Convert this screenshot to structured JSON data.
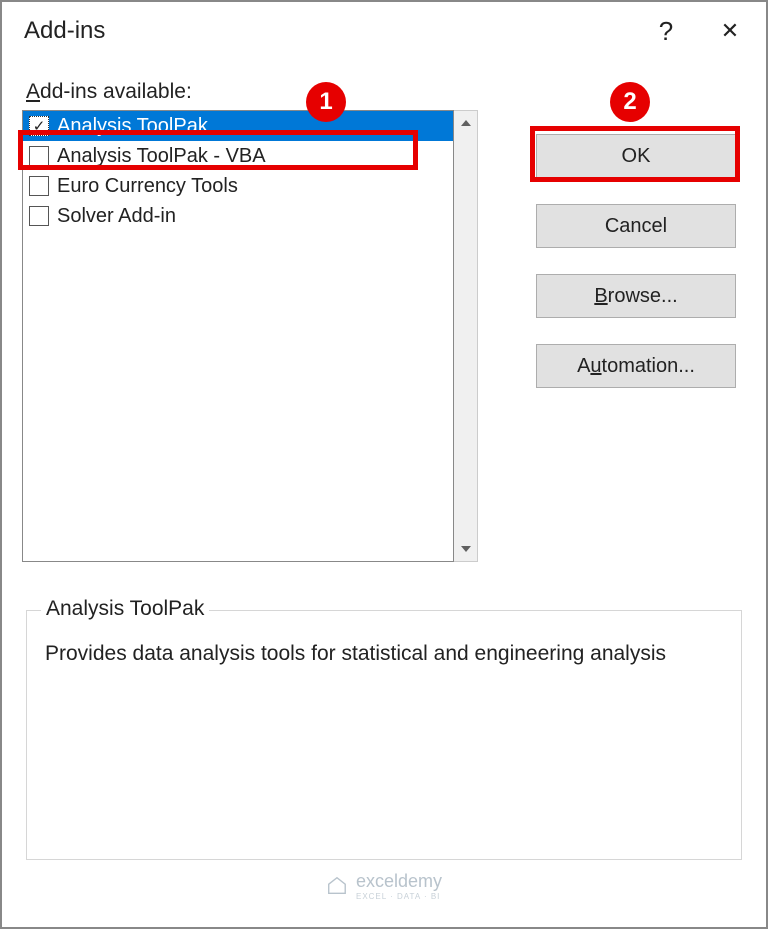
{
  "titlebar": {
    "title": "Add-ins",
    "help_label": "?",
    "close_label": "✕"
  },
  "label_prefix": "A",
  "label_rest": "dd-ins available:",
  "addins": [
    {
      "label": "Analysis ToolPak",
      "checked": true,
      "selected": true
    },
    {
      "label": "Analysis ToolPak - VBA",
      "checked": false,
      "selected": false
    },
    {
      "label": "Euro Currency Tools",
      "checked": false,
      "selected": false
    },
    {
      "label": "Solver Add-in",
      "checked": false,
      "selected": false
    }
  ],
  "buttons": {
    "ok": "OK",
    "cancel": "Cancel",
    "browse_prefix": "B",
    "browse_rest": "rowse...",
    "automation_pre": "A",
    "automation_u": "u",
    "automation_post": "tomation..."
  },
  "callouts": {
    "one": "1",
    "two": "2"
  },
  "description": {
    "title": "Analysis ToolPak",
    "body": "Provides data analysis tools for statistical and engineering analysis"
  },
  "watermark": {
    "name": "exceldemy",
    "sub": "EXCEL · DATA · BI"
  }
}
